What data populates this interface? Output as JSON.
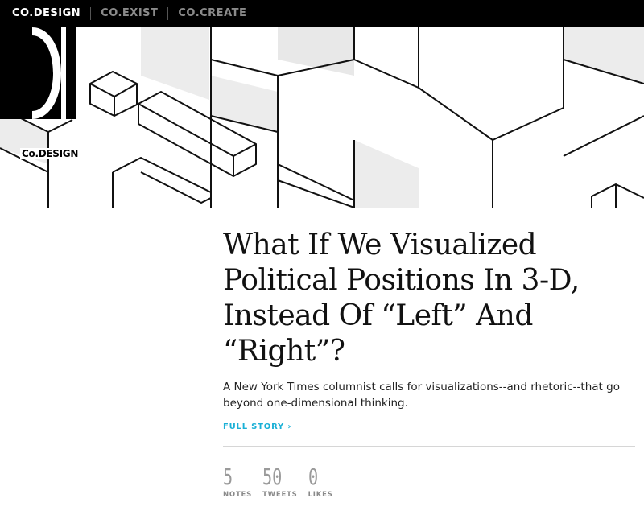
{
  "topnav": {
    "items": [
      "CO.DESIGN",
      "CO.EXIST",
      "CO.CREATE"
    ]
  },
  "logo": {
    "label": "Co.DESIGN"
  },
  "article": {
    "headline": "What If We Visualized Political Positions In 3-D, Instead Of “Left” And “Right”?",
    "dek": "A New York Times columnist calls for visualizations--and rhetoric--that go beyond one-dimensional thinking.",
    "cta": "FULL STORY ›"
  },
  "stats": [
    {
      "value": "5",
      "label": "NOTES"
    },
    {
      "value": "50",
      "label": "TWEETS"
    },
    {
      "value": "0",
      "label": "LIKES"
    }
  ],
  "colors": {
    "topbar": "#000000",
    "accent": "#1ab0d6",
    "stat_gray": "#9a9a9a"
  }
}
